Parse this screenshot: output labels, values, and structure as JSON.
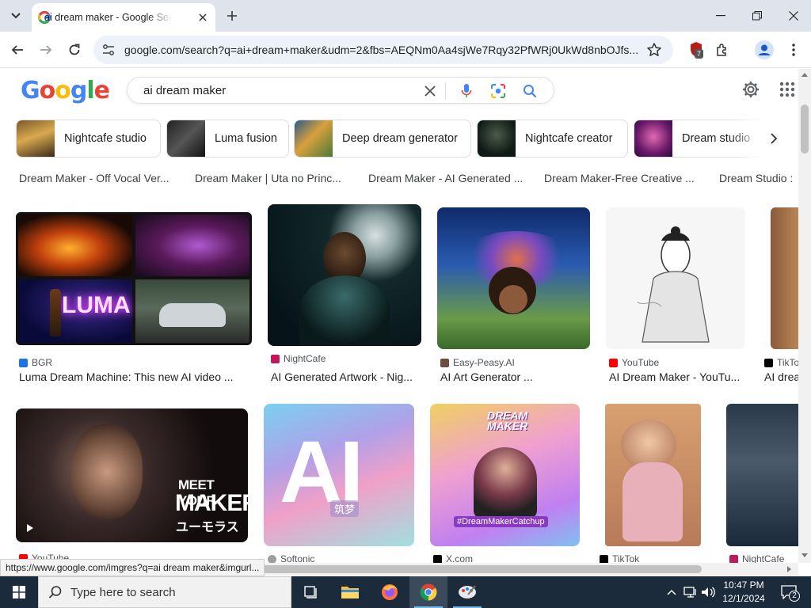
{
  "browser": {
    "tab_title": "ai dream maker - Google Search",
    "url": "google.com/search?q=ai+dream+maker&udm=2&fbs=AEQNm0Aa4sjWe7Rqy32PfWRj0UkWd8nbOJfs...",
    "extension_badge": "7"
  },
  "google": {
    "logo_letters": [
      "G",
      "o",
      "o",
      "g",
      "l",
      "e"
    ],
    "query": "ai dream maker",
    "chips": [
      {
        "label": "Nightcafe studio"
      },
      {
        "label": "Luma fusion"
      },
      {
        "label": "Deep dream generator"
      },
      {
        "label": "Nightcafe creator"
      },
      {
        "label": "Dream studio"
      }
    ]
  },
  "results": {
    "prev_row_captions": [
      "Dream Maker - Off Vocal Ver...",
      "Dream Maker | Uta no Princ...",
      "Dream Maker - AI Generated ...",
      "Dream Maker-Free Creative ...",
      "Dream Studio :"
    ],
    "row1": [
      {
        "source": "BGR",
        "title": "Luma Dream Machine: This new AI video ...",
        "fav_color": "#1a73e8",
        "luma_text": "LUMA"
      },
      {
        "source": "NightCafe",
        "title": "AI Generated Artwork - Nig...",
        "fav_color": "#c2185b"
      },
      {
        "source": "Easy-Peasy.AI",
        "title": "AI Art Generator ...",
        "fav_color": "#6d4c41"
      },
      {
        "source": "YouTube",
        "title": "AI Dream Maker - YouTu...",
        "fav_color": "#ff0000"
      },
      {
        "source": "TikTo",
        "title": "AI drea",
        "fav_color": "#000000"
      }
    ],
    "row2": [
      {
        "source": "YouTube",
        "fav_color": "#ff0000",
        "overlay_1": "MEET YOUR",
        "overlay_2": "MAKER",
        "overlay_3": "ユーモラス"
      },
      {
        "source": "Softonic",
        "fav_color": "#9e9e9e",
        "overlay_1": "AI",
        "overlay_2": "筑梦"
      },
      {
        "source": "X.com",
        "fav_color": "#000000",
        "overlay_1": "DREAM",
        "overlay_2": "MAKER",
        "overlay_3": "#DreamMakerCatchup"
      },
      {
        "source": "TikTok",
        "fav_color": "#000000"
      },
      {
        "source": "NightCafe",
        "fav_color": "#c2185b"
      }
    ]
  },
  "status_url": "https://www.google.com/imgres?q=ai dream maker&imgurl...",
  "taskbar": {
    "search_placeholder": "Type here to search",
    "time": "10:47 PM",
    "date": "12/1/2024",
    "notification_count": "2"
  }
}
